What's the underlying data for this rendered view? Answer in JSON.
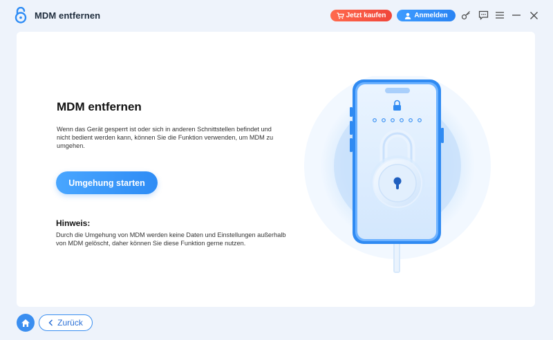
{
  "app": {
    "title": "MDM entfernen"
  },
  "titlebar": {
    "buy_label": "Jetzt kaufen",
    "login_label": "Anmelden",
    "icons": [
      "key-icon",
      "feedback-icon",
      "menu-icon",
      "minimize-icon",
      "close-icon"
    ]
  },
  "main": {
    "heading": "MDM entfernen",
    "description": "Wenn das Gerät gesperrt ist oder sich in anderen Schnittstellen befindet und nicht bedient werden kann, können Sie die Funktion verwenden, um MDM zu umgehen.",
    "start_label": "Umgehung starten",
    "note_title": "Hinweis:",
    "note_text": "Durch die Umgehung von MDM werden keine Daten und Einstellungen außerhalb von MDM gelöscht, daher können Sie diese Funktion gerne nutzen."
  },
  "footer": {
    "back_label": "Zurück"
  },
  "colors": {
    "accent": "#2e8cf5",
    "buy": "#f0463a",
    "background": "#eef3fb"
  }
}
